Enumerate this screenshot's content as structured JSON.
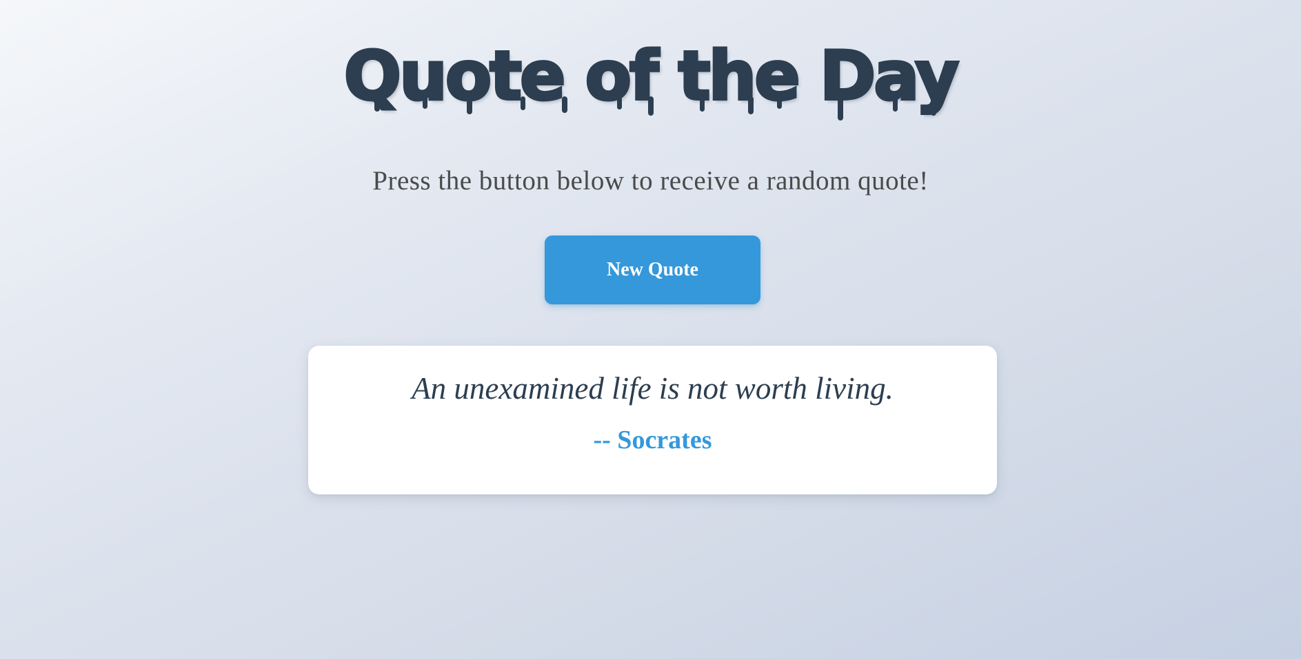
{
  "header": {
    "title": "Quote of the Day",
    "subtitle": "Press the button below to receive a random quote!"
  },
  "actions": {
    "new_quote_label": "New Quote"
  },
  "quote_card": {
    "text": "An unexamined life is not worth living.",
    "author": "-- Socrates"
  },
  "colors": {
    "title": "#2c3e50",
    "button": "#3498db",
    "author": "#3498db",
    "card_background": "#ffffff"
  }
}
